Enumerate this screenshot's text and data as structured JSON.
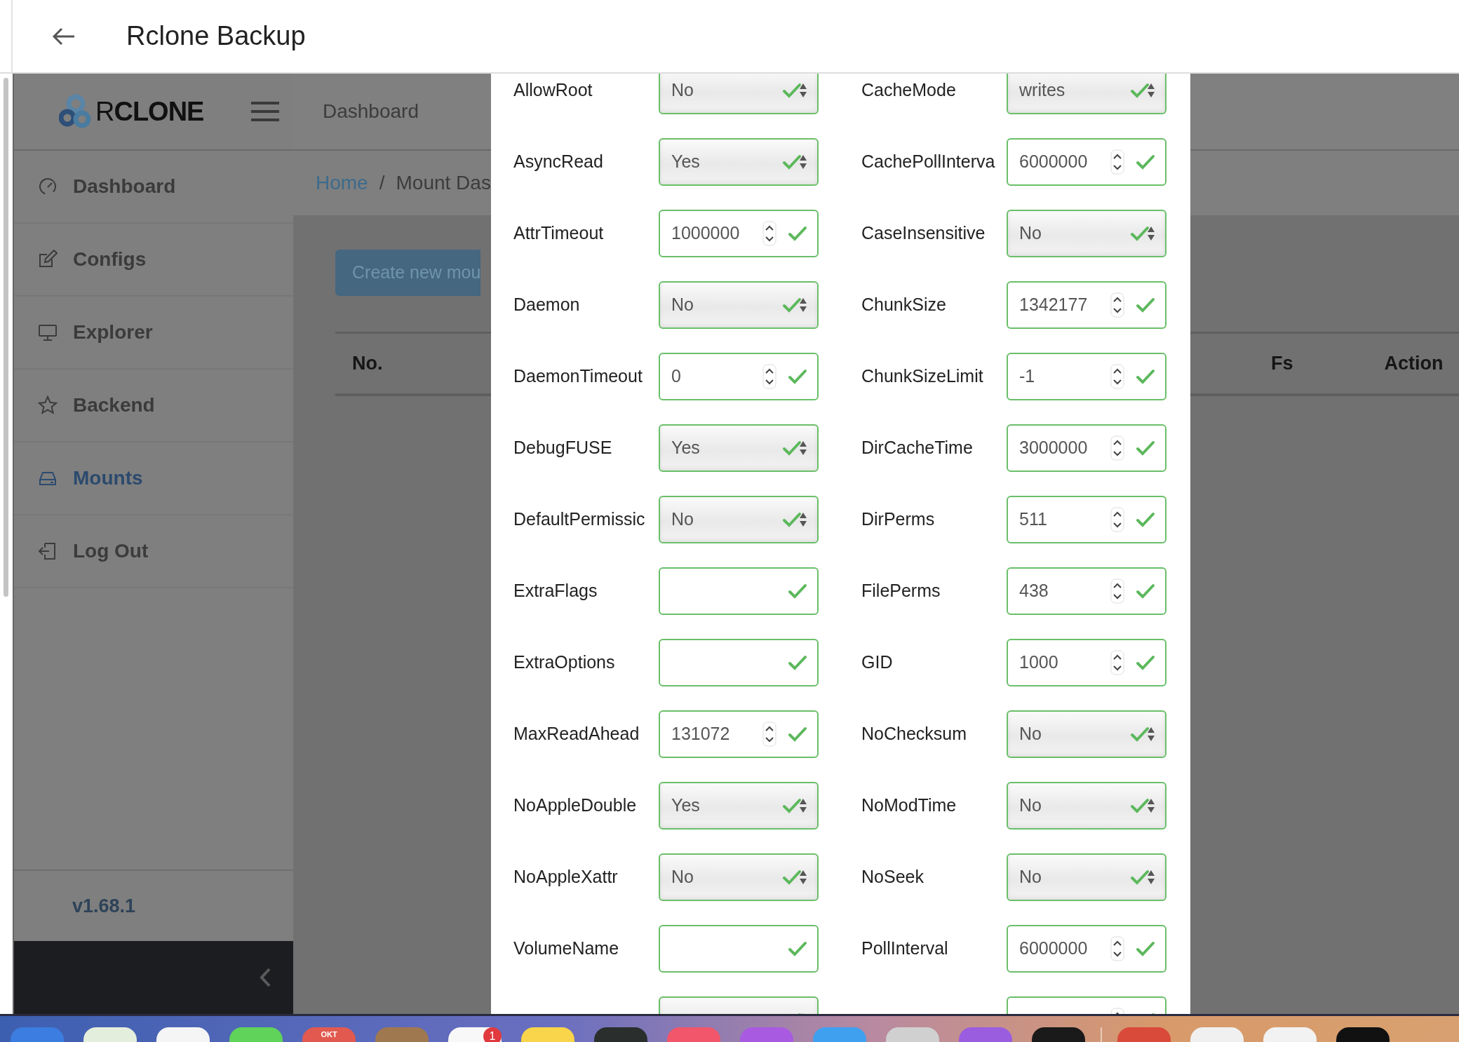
{
  "app_bar": {
    "title": "Rclone Backup"
  },
  "header": {
    "logo": "R**CLONE**",
    "title": "Dashboard"
  },
  "sidebar": {
    "items": [
      {
        "label": "Dashboard",
        "selected": false
      },
      {
        "label": "Configs",
        "selected": false
      },
      {
        "label": "Explorer",
        "selected": false
      },
      {
        "label": "Backend",
        "selected": false
      },
      {
        "label": "Mounts",
        "selected": true
      },
      {
        "label": "Log Out",
        "selected": false
      }
    ],
    "version": "v1.68.1"
  },
  "breadcrumb": {
    "items": [
      "Home",
      "Mount Das"
    ],
    "separator": "/"
  },
  "create_button": "Create new mou",
  "table": {
    "columns": [
      "No.",
      "Fs",
      "Action"
    ]
  },
  "modal": {
    "fields": [
      {
        "label": "AllowRoot",
        "kind": "select",
        "value": "No"
      },
      {
        "label": "CacheMode",
        "kind": "select",
        "value": "writes"
      },
      {
        "label": "AsyncRead",
        "kind": "select",
        "value": "Yes"
      },
      {
        "label": "CachePollInterva",
        "kind": "number",
        "value": "6000000"
      },
      {
        "label": "AttrTimeout",
        "kind": "number",
        "value": "1000000"
      },
      {
        "label": "CaseInsensitive",
        "kind": "select",
        "value": "No"
      },
      {
        "label": "Daemon",
        "kind": "select",
        "value": "No"
      },
      {
        "label": "ChunkSize",
        "kind": "number",
        "value": "1342177"
      },
      {
        "label": "DaemonTimeout",
        "kind": "number",
        "value": "0"
      },
      {
        "label": "ChunkSizeLimit",
        "kind": "number",
        "value": "-1"
      },
      {
        "label": "DebugFUSE",
        "kind": "select",
        "value": "Yes"
      },
      {
        "label": "DirCacheTime",
        "kind": "number",
        "value": "3000000"
      },
      {
        "label": "DefaultPermissic",
        "kind": "select",
        "value": "No"
      },
      {
        "label": "DirPerms",
        "kind": "number",
        "value": "511"
      },
      {
        "label": "ExtraFlags",
        "kind": "text"
      },
      {
        "label": "FilePerms",
        "kind": "number",
        "value": "438"
      },
      {
        "label": "ExtraOptions",
        "kind": "text"
      },
      {
        "label": "GID",
        "kind": "number",
        "value": "1000"
      },
      {
        "label": "MaxReadAhead",
        "kind": "number",
        "value": "131072"
      },
      {
        "label": "NoChecksum",
        "kind": "select",
        "value": "No"
      },
      {
        "label": "NoAppleDouble",
        "kind": "select",
        "value": "Yes"
      },
      {
        "label": "NoModTime",
        "kind": "select",
        "value": "No"
      },
      {
        "label": "NoAppleXattr",
        "kind": "select",
        "value": "No"
      },
      {
        "label": "NoSeek",
        "kind": "select",
        "value": "No"
      },
      {
        "label": "VolumeName",
        "kind": "text"
      },
      {
        "label": "PollInterval",
        "kind": "number",
        "value": "6000000"
      },
      {
        "kind": "select"
      },
      {
        "kind": "number"
      }
    ]
  },
  "dock": {
    "items": [
      {
        "color": "#3b7de0"
      },
      {
        "color": "#e4eedc"
      },
      {
        "color": "#f5f5f5"
      },
      {
        "color": "#5fd35a"
      },
      {
        "color": "#e25a4f",
        "label": "OKT"
      },
      {
        "color": "#a07850"
      },
      {
        "color": "#f8f8f8",
        "badge": "1"
      },
      {
        "color": "#f8d54a"
      },
      {
        "color": "#2a2f2e"
      },
      {
        "color": "#f2566a"
      },
      {
        "color": "#a85ae0"
      },
      {
        "color": "#3fa0f0"
      },
      {
        "color": "#d0d0d0"
      },
      {
        "color": "#9b5de0"
      },
      {
        "color": "#1a1a1a"
      },
      {
        "color": "#d94a3a",
        "separated": true
      },
      {
        "color": "#f0f0f0"
      },
      {
        "color": "#f2f2f2"
      },
      {
        "color": "#111111"
      }
    ]
  }
}
